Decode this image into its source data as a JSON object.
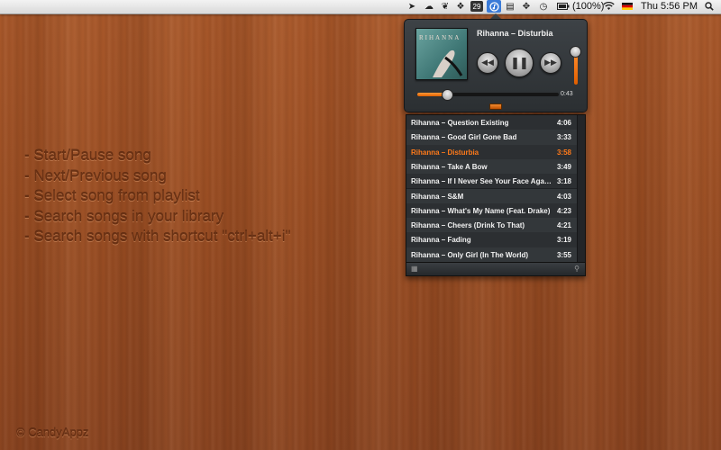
{
  "menubar": {
    "battery_text": "(100%)",
    "clock": "Thu 5:56 PM",
    "icons": [
      "cursor-icon",
      "cloud-icon",
      "evernote-icon",
      "dropbox-icon",
      "calendar-icon",
      "music-player-icon",
      "document-icon",
      "move-icon",
      "time-machine-icon",
      "battery-icon",
      "wifi-icon",
      "german-flag-icon",
      "search-icon"
    ],
    "calendar_day": "29"
  },
  "features": [
    "- Start/Pause song",
    "- Next/Previous song",
    "- Select song from playlist",
    "- Search songs in your library",
    "- Search songs with shortcut \"ctrl+alt+i\""
  ],
  "copyright": "© CandyAppz",
  "player": {
    "now_playing": "Rihanna – Disturbia",
    "album_text": "RIHANNA",
    "elapsed": "0:43",
    "progress": 0.2,
    "volume": 0.8,
    "prev_icon": "rewind-icon",
    "play_icon": "pause-icon",
    "next_icon": "fast-forward-icon"
  },
  "playlist": [
    {
      "title": "Rihanna – Question Existing",
      "duration": "4:06"
    },
    {
      "title": "Rihanna – Good Girl Gone Bad",
      "duration": "3:33"
    },
    {
      "title": "Rihanna – Disturbia",
      "duration": "3:58",
      "active": true
    },
    {
      "title": "Rihanna – Take A Bow",
      "duration": "3:49"
    },
    {
      "title": "Rihanna – If I Never See Your Face Again...",
      "duration": "3:18"
    },
    {
      "title": "Rihanna – S&M",
      "duration": "4:03"
    },
    {
      "title": "Rihanna – What's My Name (Feat. Drake)",
      "duration": "4:23"
    },
    {
      "title": "Rihanna – Cheers (Drink To That)",
      "duration": "4:21"
    },
    {
      "title": "Rihanna – Fading",
      "duration": "3:19"
    },
    {
      "title": "Rihanna – Only Girl (In The World)",
      "duration": "3:55"
    }
  ],
  "colors": {
    "accent": "#ff7a1a",
    "wood": "#9a4f24",
    "feature_text": "#6b3214"
  }
}
